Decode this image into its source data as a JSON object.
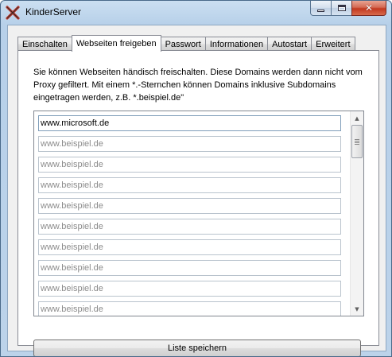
{
  "window": {
    "title": "KinderServer",
    "icon": "kinderserver-x-icon",
    "caption_buttons": {
      "minimize": "minimize-icon",
      "maximize": "maximize-icon",
      "close": "✕"
    }
  },
  "tabs": [
    {
      "label": "Einschalten",
      "active": false
    },
    {
      "label": "Webseiten freigeben",
      "active": true
    },
    {
      "label": "Passwort",
      "active": false
    },
    {
      "label": "Informationen",
      "active": false
    },
    {
      "label": "Autostart",
      "active": false
    },
    {
      "label": "Erweitert",
      "active": false
    }
  ],
  "panel": {
    "description": "Sie können Webseiten händisch freischalten. Diese Domains werden dann nicht vom Proxy gefiltert. Mit einem *.-Sternchen können Domains inklusive Subdomains eingetragen werden, z.B. *.beispiel.de\"",
    "domains": [
      {
        "value": "www.microsoft.de",
        "placeholder": "www.beispiel.de"
      },
      {
        "value": "",
        "placeholder": "www.beispiel.de"
      },
      {
        "value": "",
        "placeholder": "www.beispiel.de"
      },
      {
        "value": "",
        "placeholder": "www.beispiel.de"
      },
      {
        "value": "",
        "placeholder": "www.beispiel.de"
      },
      {
        "value": "",
        "placeholder": "www.beispiel.de"
      },
      {
        "value": "",
        "placeholder": "www.beispiel.de"
      },
      {
        "value": "",
        "placeholder": "www.beispiel.de"
      },
      {
        "value": "",
        "placeholder": "www.beispiel.de"
      },
      {
        "value": "",
        "placeholder": "www.beispiel.de"
      }
    ],
    "scrollbar": {
      "up": "▲",
      "down": "▼"
    },
    "save_label": "Liste speichern"
  },
  "colors": {
    "titlebar": "#b9d1ea",
    "close_button": "#c7432b",
    "client_bg": "#f0f0f0"
  }
}
